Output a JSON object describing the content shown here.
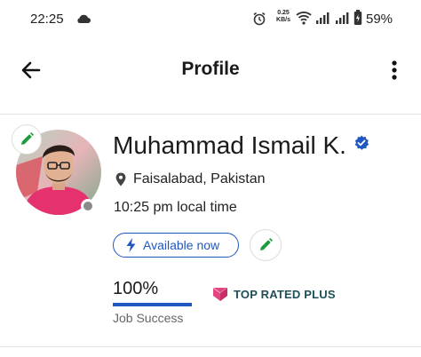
{
  "status_bar": {
    "time": "22:25",
    "network_speed_value": "0.25",
    "network_speed_unit": "KB/s",
    "battery_percent": "59%",
    "icons": [
      "cloud-icon",
      "alarm-icon",
      "wifi-icon",
      "signal-icon",
      "signal-icon",
      "battery-icon"
    ]
  },
  "header": {
    "title": "Profile",
    "back_icon": "arrow-left-icon",
    "menu_icon": "more-vertical-icon"
  },
  "profile": {
    "name": "Muhammad Ismail K.",
    "verified": true,
    "location": "Faisalabad, Pakistan",
    "local_time": "10:25 pm local time",
    "availability_label": "Available now",
    "online_status": "offline"
  },
  "stats": {
    "job_success_value": "100%",
    "job_success_fraction": 1.0,
    "job_success_label": "Job Success",
    "badge_label": "TOP RATED PLUS"
  },
  "colors": {
    "accent_blue": "#1f57c3",
    "edit_green": "#1f9a3c",
    "badge_pink": "#e2457f",
    "badge_text": "#1e4f57"
  }
}
